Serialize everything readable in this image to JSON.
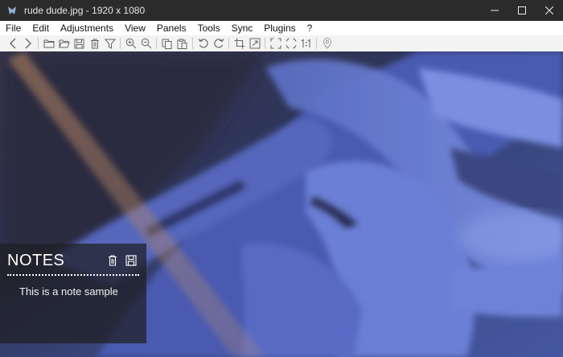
{
  "window": {
    "title": "rude dude.jpg  -  1920 x 1080",
    "app_icon": "app-icon",
    "controls": [
      "minimize-icon",
      "maximize-icon",
      "close-icon"
    ]
  },
  "menu": {
    "items": [
      "File",
      "Edit",
      "Adjustments",
      "View",
      "Panels",
      "Tools",
      "Sync",
      "Plugins",
      "?"
    ]
  },
  "toolbar": {
    "icons": [
      "back-icon",
      "forward-icon",
      "new-folder-icon",
      "open-folder-icon",
      "save-icon",
      "delete-icon",
      "filter-icon",
      "zoom-in-icon",
      "zoom-out-icon",
      "copy-icon",
      "paste-icon",
      "rotate-left-icon",
      "rotate-right-icon",
      "crop-icon",
      "resize-icon",
      "fit-screen-icon",
      "fullscreen-icon",
      "actual-size-icon",
      "location-pin-icon"
    ]
  },
  "notes": {
    "title": "NOTES",
    "text": "This is a note sample",
    "actions": [
      "trash-icon",
      "save-icon"
    ]
  }
}
